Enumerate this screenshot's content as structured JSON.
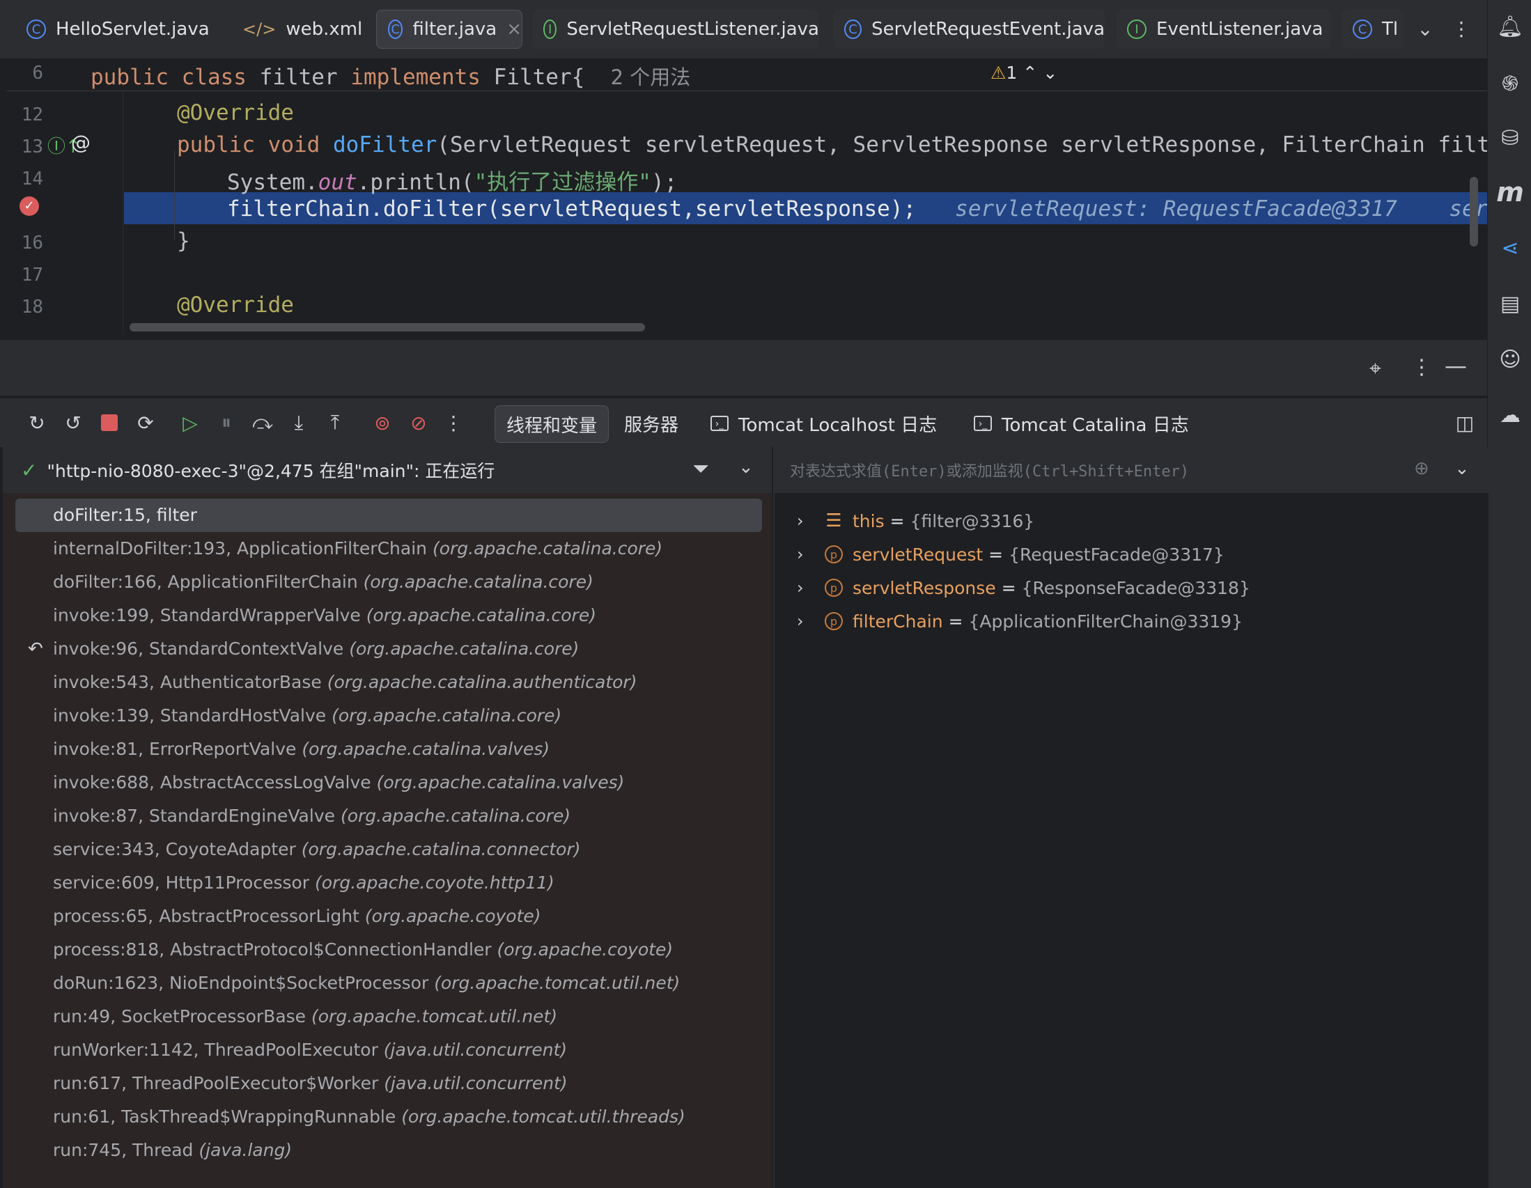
{
  "editor_tabs": [
    {
      "label": "HelloServlet.java",
      "kind": "class",
      "state": "normal"
    },
    {
      "label": "web.xml",
      "kind": "xml",
      "state": "normal"
    },
    {
      "label": "filter.java",
      "kind": "class",
      "state": "active"
    },
    {
      "label": "ServletRequestListener.java",
      "kind": "interface",
      "state": "dim"
    },
    {
      "label": "ServletRequestEvent.java",
      "kind": "class",
      "state": "dim"
    },
    {
      "label": "EventListener.java",
      "kind": "interface",
      "state": "dim"
    },
    {
      "label": "Tl",
      "kind": "class",
      "state": "dim"
    }
  ],
  "editor": {
    "sticky_line_number": "6",
    "sticky_code_kw1": "public",
    "sticky_code_kw2": "class",
    "sticky_code_name": "filter",
    "sticky_code_kw3": "implements",
    "sticky_code_iface": "Filter{",
    "sticky_usages": "2 个用法",
    "warning_count": "1",
    "lines": [
      {
        "num": "12",
        "code_ann": "@Override"
      },
      {
        "num": "13"
      },
      {
        "num": "14"
      },
      {
        "num": ""
      },
      {
        "num": "16",
        "code": "}"
      },
      {
        "num": "17"
      },
      {
        "num": "18",
        "code_ann": "@Override"
      }
    ],
    "line13": {
      "kw1": "public",
      "kw2": "void",
      "fn": "doFilter",
      "rest": "(ServletRequest servletRequest, ServletResponse servletResponse, FilterChain filterCh"
    },
    "line14": {
      "pre": "System.",
      "field": "out",
      "call": ".println(",
      "str": "\"执行了过滤操作\"",
      "post": ");"
    },
    "line15": {
      "code": "filterChain.doFilter(servletRequest,servletResponse);",
      "inline1": "servletRequest: RequestFacade@3317",
      "inline2": "servlet"
    }
  },
  "debug": {
    "tabs": [
      {
        "label": "线程和变量",
        "active": true
      },
      {
        "label": "服务器",
        "active": false
      },
      {
        "label": "Tomcat Localhost 日志",
        "active": false,
        "terminal": true
      },
      {
        "label": "Tomcat Catalina 日志",
        "active": false,
        "terminal": true
      }
    ],
    "thread": "\"http-nio-8080-exec-3\"@2,475 在组\"main\": 正在运行",
    "frames": [
      {
        "method": "doFilter:15, filter",
        "pkg": "",
        "selected": true
      },
      {
        "method": "internalDoFilter:193, ApplicationFilterChain",
        "pkg": "(org.apache.catalina.core)"
      },
      {
        "method": "doFilter:166, ApplicationFilterChain",
        "pkg": "(org.apache.catalina.core)"
      },
      {
        "method": "invoke:199, StandardWrapperValve",
        "pkg": "(org.apache.catalina.core)"
      },
      {
        "method": "invoke:96, StandardContextValve",
        "pkg": "(org.apache.catalina.core)",
        "drop": true
      },
      {
        "method": "invoke:543, AuthenticatorBase",
        "pkg": "(org.apache.catalina.authenticator)"
      },
      {
        "method": "invoke:139, StandardHostValve",
        "pkg": "(org.apache.catalina.core)"
      },
      {
        "method": "invoke:81, ErrorReportValve",
        "pkg": "(org.apache.catalina.valves)"
      },
      {
        "method": "invoke:688, AbstractAccessLogValve",
        "pkg": "(org.apache.catalina.valves)"
      },
      {
        "method": "invoke:87, StandardEngineValve",
        "pkg": "(org.apache.catalina.core)"
      },
      {
        "method": "service:343, CoyoteAdapter",
        "pkg": "(org.apache.catalina.connector)"
      },
      {
        "method": "service:609, Http11Processor",
        "pkg": "(org.apache.coyote.http11)"
      },
      {
        "method": "process:65, AbstractProcessorLight",
        "pkg": "(org.apache.coyote)"
      },
      {
        "method": "process:818, AbstractProtocol$ConnectionHandler",
        "pkg": "(org.apache.coyote)"
      },
      {
        "method": "doRun:1623, NioEndpoint$SocketProcessor",
        "pkg": "(org.apache.tomcat.util.net)"
      },
      {
        "method": "run:49, SocketProcessorBase",
        "pkg": "(org.apache.tomcat.util.net)"
      },
      {
        "method": "runWorker:1142, ThreadPoolExecutor",
        "pkg": "(java.util.concurrent)"
      },
      {
        "method": "run:617, ThreadPoolExecutor$Worker",
        "pkg": "(java.util.concurrent)"
      },
      {
        "method": "run:61, TaskThread$WrappingRunnable",
        "pkg": "(org.apache.tomcat.util.threads)"
      },
      {
        "method": "run:745, Thread",
        "pkg": "(java.lang)"
      }
    ],
    "eval_placeholder": "对表达式求值(Enter)或添加监视(Ctrl+Shift+Enter)",
    "variables": [
      {
        "name": "this",
        "value": "{filter@3316}",
        "icon": "stack"
      },
      {
        "name": "servletRequest",
        "value": "{RequestFacade@3317}",
        "icon": "p"
      },
      {
        "name": "servletResponse",
        "value": "{ResponseFacade@3318}",
        "icon": "p"
      },
      {
        "name": "filterChain",
        "value": "{ApplicationFilterChain@3319}",
        "icon": "p"
      }
    ]
  },
  "colors": {
    "accent": "#548af7",
    "selection": "#214283",
    "breakpoint": "#db5c5c"
  }
}
